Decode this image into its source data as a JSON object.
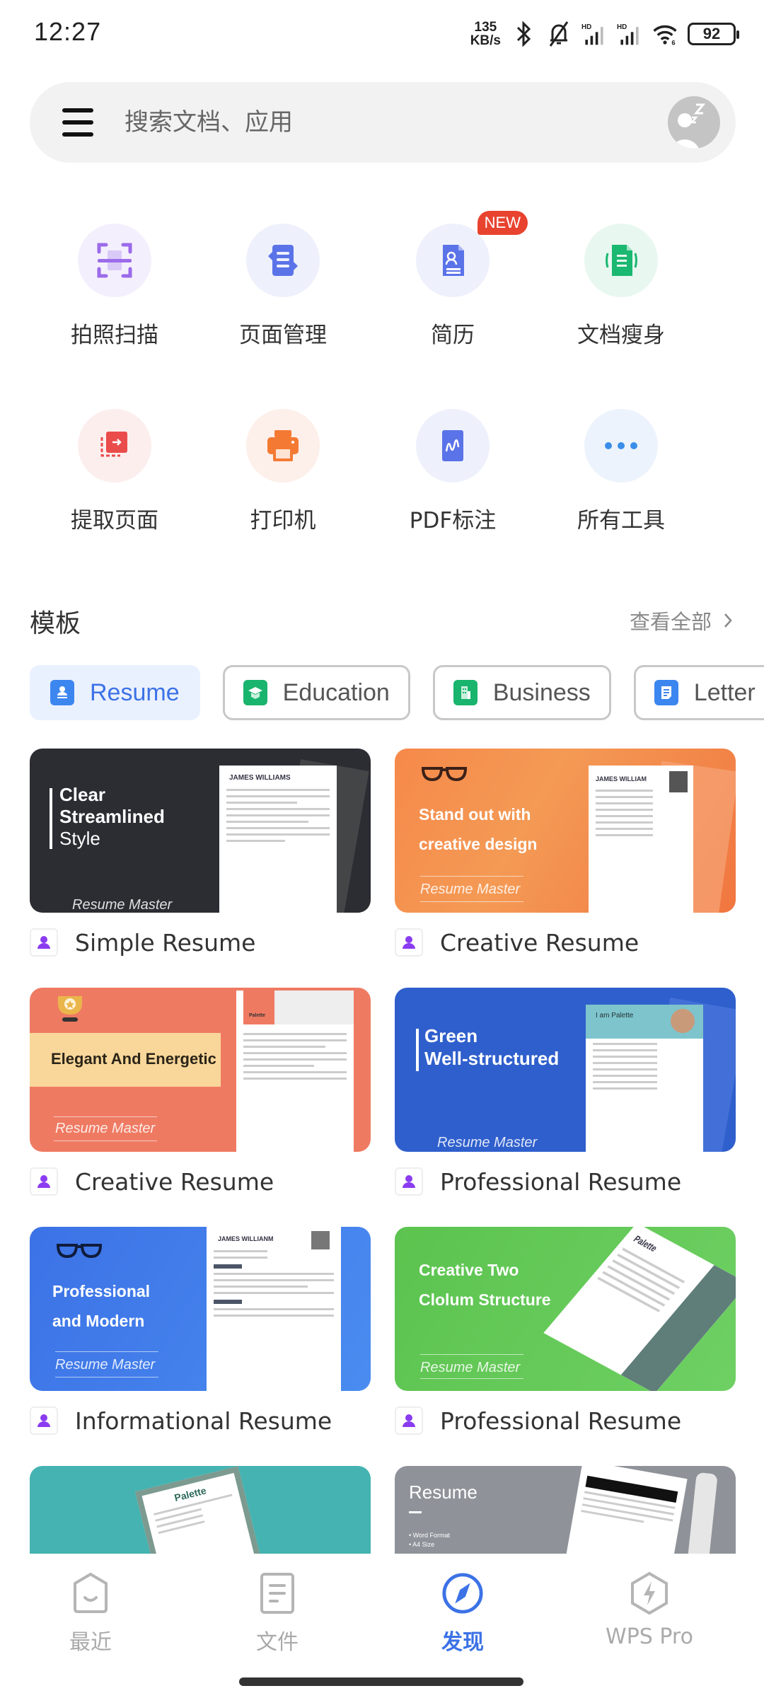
{
  "status_bar": {
    "time": "12:27",
    "net_speed_value": "135",
    "net_speed_unit": "KB/s",
    "battery": "92",
    "icons": [
      "bluetooth-icon",
      "silent-bell-icon",
      "hd-signal-icon",
      "hd-signal-icon",
      "wifi-6-icon",
      "battery-icon"
    ]
  },
  "search": {
    "placeholder": "搜索文档、应用",
    "menu_icon": "hamburger-menu-icon",
    "avatar_icon": "sleeping-user-avatar"
  },
  "tools": [
    {
      "label": "拍照扫描",
      "icon": "scan-icon",
      "bg": "#f4effd",
      "color": "#9b6bea"
    },
    {
      "label": "页面管理",
      "icon": "page-manage-icon",
      "bg": "#eef1fc",
      "color": "#5b73e8"
    },
    {
      "label": "简历",
      "icon": "resume-icon",
      "bg": "#eef1fc",
      "color": "#5b73e8",
      "badge": "NEW"
    },
    {
      "label": "文档瘦身",
      "icon": "doc-slim-icon",
      "bg": "#e8f8f0",
      "color": "#1ab870"
    },
    {
      "label": "提取页面",
      "icon": "extract-page-icon",
      "bg": "#fdeeee",
      "color": "#ea4b4b"
    },
    {
      "label": "打印机",
      "icon": "printer-icon",
      "bg": "#fdefe9",
      "color": "#f47a34"
    },
    {
      "label": "PDF标注",
      "icon": "pdf-annotate-icon",
      "bg": "#eef1fc",
      "color": "#5b73e8"
    },
    {
      "label": "所有工具",
      "icon": "more-icon",
      "bg": "#ecf3fc",
      "color": "#3a8ee8"
    }
  ],
  "templates": {
    "title": "模板",
    "view_all": "查看全部",
    "chips": [
      {
        "label": "Resume",
        "icon": "resume-chip-icon",
        "color": "#3c86f0",
        "active": true
      },
      {
        "label": "Education",
        "icon": "graduation-cap-icon",
        "color": "#19b46d",
        "active": false
      },
      {
        "label": "Business",
        "icon": "building-icon",
        "color": "#19b46d",
        "active": false
      },
      {
        "label": "Letter",
        "icon": "letter-icon",
        "color": "#3c86f0",
        "active": false
      }
    ],
    "brand": "Resume Master",
    "cards": [
      {
        "title": "Simple Resume",
        "banner": [
          "Clear",
          "Streamlined",
          "Style"
        ],
        "paper_name": "JAMES WILLIAMS",
        "bg": "#2c2d33"
      },
      {
        "title": "Creative Resume",
        "banner": [
          "Stand out with",
          "creative design"
        ],
        "paper_name": "JAMES WILLIAM",
        "bg": "#f47f3f"
      },
      {
        "title": "Creative Resume",
        "banner": [
          "Elegant And Energetic"
        ],
        "paper_name": "Palette",
        "bg": "#ef7a62"
      },
      {
        "title": "Professional Resume",
        "banner": [
          "Green",
          "Well-structured"
        ],
        "paper_name": "I am Palette",
        "bg": "#2f5fcc"
      },
      {
        "title": "Informational Resume",
        "banner": [
          "Professional",
          "and Modern"
        ],
        "paper_name": "JAMES WILLIANM",
        "bg": "#3c72e6"
      },
      {
        "title": "Professional Resume",
        "banner": [
          "Creative Two",
          "Clolum Structure"
        ],
        "paper_name": "Palette",
        "bg": "#63c95a"
      },
      {
        "title": "",
        "banner": [],
        "paper_name": "Palette",
        "bg": "#45b3b1"
      },
      {
        "title": "",
        "banner": [
          "Resume"
        ],
        "bullets": [
          "• Word Format",
          "• A4 Size"
        ],
        "paper_name": "",
        "bg": "#8f9399"
      }
    ]
  },
  "bottom_nav": [
    {
      "label": "最近",
      "icon": "recent-icon",
      "active": false
    },
    {
      "label": "文件",
      "icon": "files-icon",
      "active": false
    },
    {
      "label": "发现",
      "icon": "compass-icon",
      "active": true
    },
    {
      "label": "WPS Pro",
      "icon": "wps-pro-icon",
      "active": false
    }
  ]
}
